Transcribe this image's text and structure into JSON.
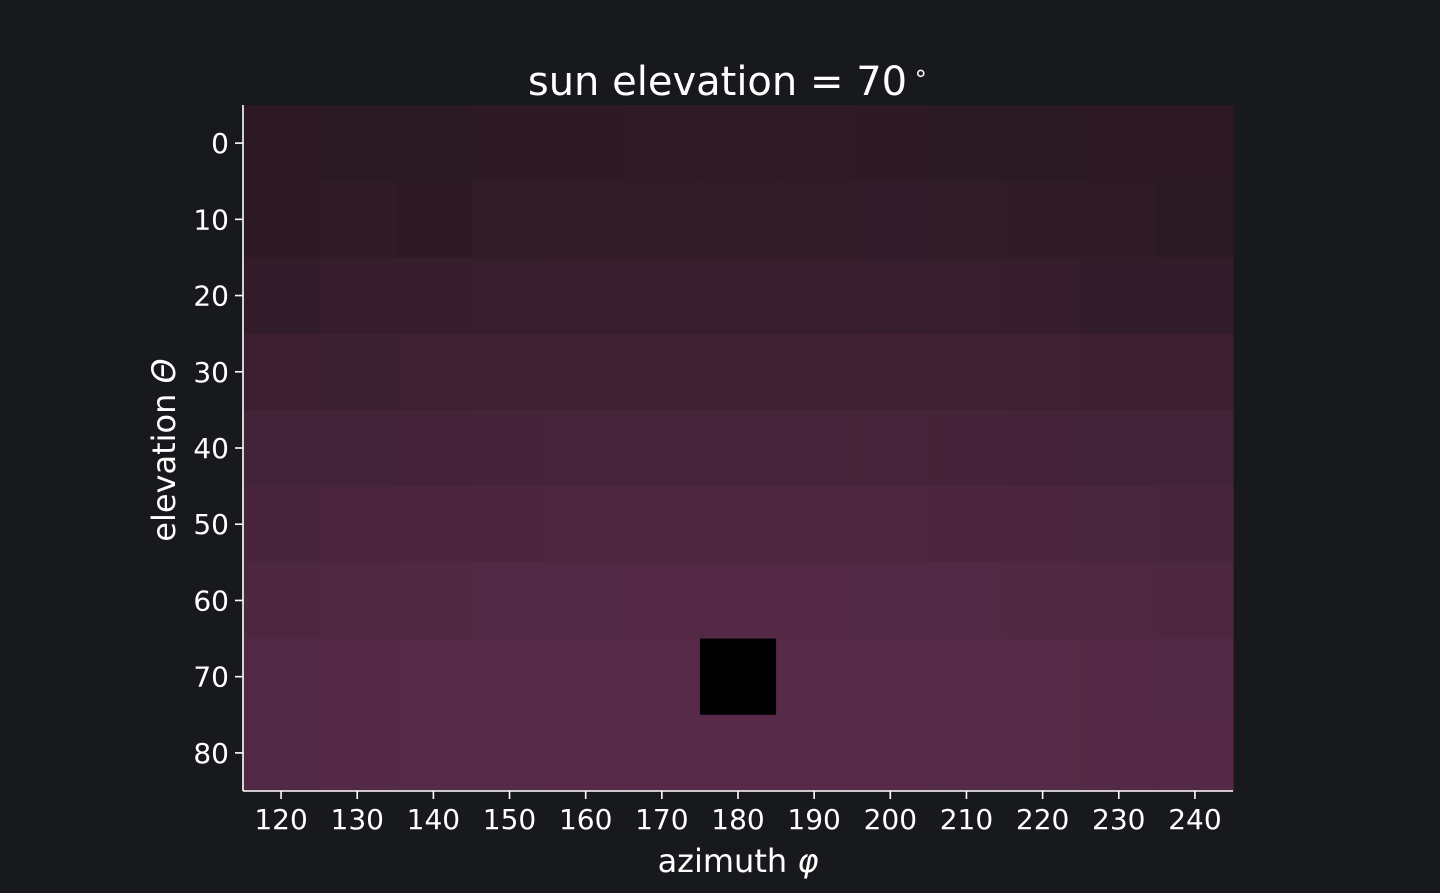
{
  "chart_data": {
    "type": "heatmap",
    "title": "sun elevation = 70$^\\circ$",
    "title_main": "sun elevation = 70",
    "title_sup": "∘",
    "xlabel_text": "azimuth ",
    "xlabel_symbol": "φ",
    "ylabel_text": "elevation ",
    "ylabel_symbol": "Θ",
    "x": [
      120,
      130,
      140,
      150,
      160,
      170,
      180,
      190,
      200,
      210,
      220,
      230,
      240
    ],
    "y": [
      0,
      10,
      20,
      30,
      40,
      50,
      60,
      70,
      80
    ],
    "xlim": [
      115,
      245
    ],
    "ylim": [
      85,
      -5
    ],
    "grid": false,
    "legend": "none",
    "colors": {
      "background": "#18191d",
      "axis": "#ffffff",
      "text": "#ffffff",
      "low": "#2b1922",
      "high": "#5a2c4b",
      "sun": "#000000"
    },
    "sun_marker": {
      "x": 180,
      "y": 70
    },
    "values": [
      [
        0.02,
        0.03,
        0.03,
        0.04,
        0.05,
        0.08,
        0.08,
        0.08,
        0.04,
        0.03,
        0.03,
        0.02,
        0.02
      ],
      [
        0.02,
        0.1,
        0.06,
        0.14,
        0.15,
        0.15,
        0.15,
        0.15,
        0.16,
        0.15,
        0.12,
        0.09,
        0.03
      ],
      [
        0.18,
        0.21,
        0.23,
        0.26,
        0.27,
        0.28,
        0.28,
        0.27,
        0.26,
        0.24,
        0.22,
        0.19,
        0.17
      ],
      [
        0.33,
        0.35,
        0.38,
        0.4,
        0.42,
        0.43,
        0.43,
        0.43,
        0.42,
        0.4,
        0.38,
        0.36,
        0.34
      ],
      [
        0.5,
        0.52,
        0.54,
        0.56,
        0.57,
        0.58,
        0.58,
        0.58,
        0.57,
        0.56,
        0.54,
        0.52,
        0.51
      ],
      [
        0.63,
        0.65,
        0.68,
        0.7,
        0.72,
        0.73,
        0.73,
        0.73,
        0.72,
        0.7,
        0.68,
        0.66,
        0.64
      ],
      [
        0.72,
        0.76,
        0.79,
        0.82,
        0.84,
        0.85,
        0.85,
        0.85,
        0.84,
        0.82,
        0.79,
        0.76,
        0.73
      ],
      [
        0.82,
        0.86,
        0.88,
        0.9,
        0.92,
        0.93,
        0.0,
        0.93,
        0.92,
        0.9,
        0.88,
        0.85,
        0.83
      ],
      [
        0.84,
        0.86,
        0.88,
        0.9,
        0.91,
        0.92,
        0.92,
        0.92,
        0.91,
        0.9,
        0.88,
        0.86,
        0.85
      ]
    ]
  }
}
